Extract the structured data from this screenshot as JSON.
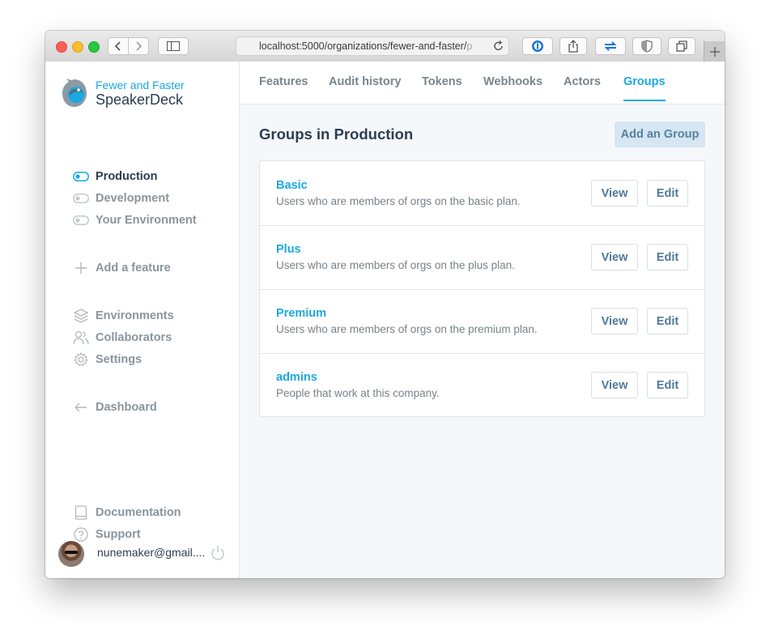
{
  "browser": {
    "url_visible": "localhost:5000/organizations/fewer-and-faster/",
    "url_faded": "p"
  },
  "brand": {
    "org_name": "Fewer and Faster",
    "app_name": "SpeakerDeck"
  },
  "sidebar": {
    "environments": [
      {
        "label": "Production",
        "active": true
      },
      {
        "label": "Development",
        "active": false
      },
      {
        "label": "Your Environment",
        "active": false
      }
    ],
    "add_feature": "Add a feature",
    "links": [
      {
        "label": "Environments",
        "icon": "layers-icon"
      },
      {
        "label": "Collaborators",
        "icon": "users-icon"
      },
      {
        "label": "Settings",
        "icon": "gear-icon"
      }
    ],
    "dashboard": "Dashboard",
    "footer_links": [
      {
        "label": "Documentation",
        "icon": "book-icon"
      },
      {
        "label": "Support",
        "icon": "help-icon"
      }
    ],
    "user_email": "nunemaker@gmail...."
  },
  "tabs": [
    {
      "label": "Features",
      "active": false
    },
    {
      "label": "Audit history",
      "active": false
    },
    {
      "label": "Tokens",
      "active": false
    },
    {
      "label": "Webhooks",
      "active": false
    },
    {
      "label": "Actors",
      "active": false
    },
    {
      "label": "Groups",
      "active": true
    }
  ],
  "main": {
    "title": "Groups in Production",
    "add_button": "Add an Group",
    "view_label": "View",
    "edit_label": "Edit",
    "groups": [
      {
        "name": "Basic",
        "description": "Users who are members of orgs on the basic plan."
      },
      {
        "name": "Plus",
        "description": "Users who are members of orgs on the plus plan."
      },
      {
        "name": "Premium",
        "description": "Users who are members of orgs on the premium plan."
      },
      {
        "name": "admins",
        "description": "People that work at this company."
      }
    ]
  },
  "colors": {
    "accent": "#1aa9e0",
    "text": "#2c3e50",
    "muted": "#77838a",
    "button_text": "#4f7b99",
    "add_button_bg": "#d6e6f2",
    "main_bg": "#f5f8fb"
  }
}
